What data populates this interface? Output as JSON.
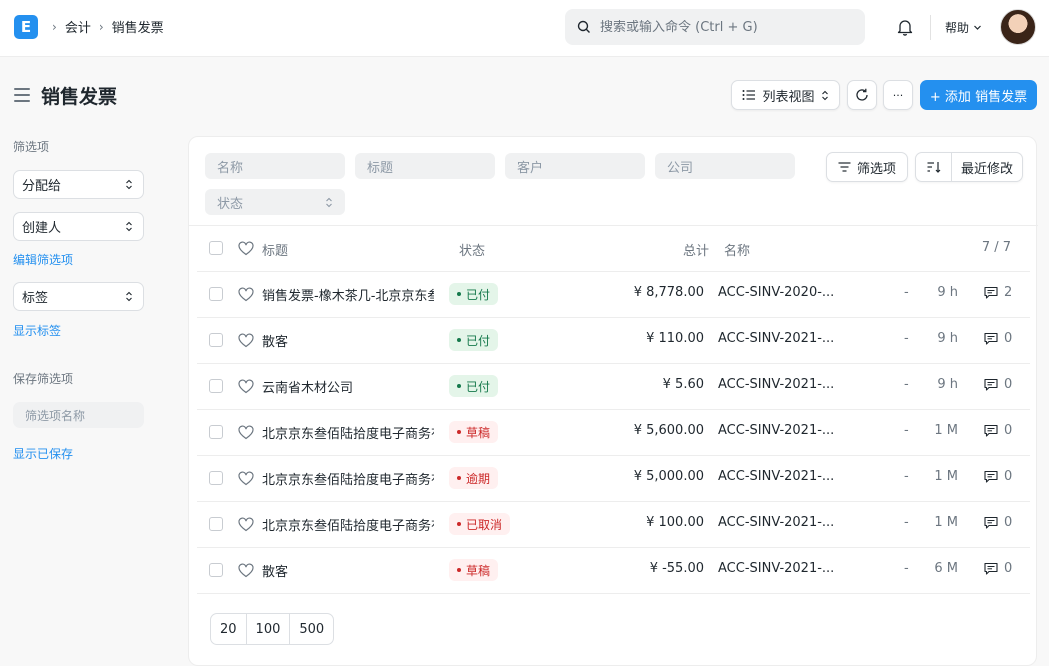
{
  "navbar": {
    "logo_letter": "E",
    "breadcrumbs": [
      "会计",
      "销售发票"
    ],
    "search_placeholder": "搜索或输入命令 (Ctrl + G)",
    "help_label": "帮助"
  },
  "page": {
    "title": "销售发票",
    "list_view_label": "列表视图",
    "more_label": "···",
    "add_label": "+ 添加 销售发票"
  },
  "sidebar": {
    "filters_heading": "筛选项",
    "assigned_to": "分配给",
    "created_by": "创建人",
    "edit_filters": "编辑筛选项",
    "tags": "标签",
    "show_tags": "显示标签",
    "saved_filters_heading": "保存筛选项",
    "filter_name_placeholder": "筛选项名称",
    "show_saved": "显示已保存"
  },
  "filters": {
    "name": "名称",
    "title": "标题",
    "customer": "客户",
    "company": "公司",
    "status": "状态",
    "filter_button": "筛选项",
    "sort_label": "最近修改"
  },
  "table": {
    "headers": {
      "title": "标题",
      "status": "状态",
      "total": "总计",
      "name": "名称",
      "count": "7 / 7"
    },
    "rows": [
      {
        "title": "销售发票-橡木茶几-北京京东叁佰陆拾度电子商务有限公司",
        "status": "已付",
        "status_kind": "paid",
        "total": "¥ 8,778.00",
        "name": "ACC-SINV-2020-...",
        "dash": "-",
        "time": "9 h",
        "comments": "2"
      },
      {
        "title": "散客",
        "status": "已付",
        "status_kind": "paid",
        "total": "¥ 110.00",
        "name": "ACC-SINV-2021-...",
        "dash": "-",
        "time": "9 h",
        "comments": "0"
      },
      {
        "title": "云南省木材公司",
        "status": "已付",
        "status_kind": "paid",
        "total": "¥ 5.60",
        "name": "ACC-SINV-2021-...",
        "dash": "-",
        "time": "9 h",
        "comments": "0"
      },
      {
        "title": "北京京东叁佰陆拾度电子商务有限公司",
        "status": "草稿",
        "status_kind": "draft",
        "total": "¥ 5,600.00",
        "name": "ACC-SINV-2021-...",
        "dash": "-",
        "time": "1 M",
        "comments": "0"
      },
      {
        "title": "北京京东叁佰陆拾度电子商务有限公司",
        "status": "逾期",
        "status_kind": "overdue",
        "total": "¥ 5,000.00",
        "name": "ACC-SINV-2021-...",
        "dash": "-",
        "time": "1 M",
        "comments": "0"
      },
      {
        "title": "北京京东叁佰陆拾度电子商务有限公司",
        "status": "已取消",
        "status_kind": "cancelled",
        "total": "¥ 100.00",
        "name": "ACC-SINV-2021-...",
        "dash": "-",
        "time": "1 M",
        "comments": "0"
      },
      {
        "title": "散客",
        "status": "草稿",
        "status_kind": "draft",
        "total": "¥ -55.00",
        "name": "ACC-SINV-2021-...",
        "dash": "-",
        "time": "6 M",
        "comments": "0"
      }
    ]
  },
  "pager": [
    "20",
    "100",
    "500"
  ],
  "colors": {
    "primary": "#2490ef",
    "paid_bg": "#e4f5e9",
    "paid_fg": "#16794c",
    "draft_bg": "#fff0f0",
    "draft_fg": "#cc2929"
  }
}
